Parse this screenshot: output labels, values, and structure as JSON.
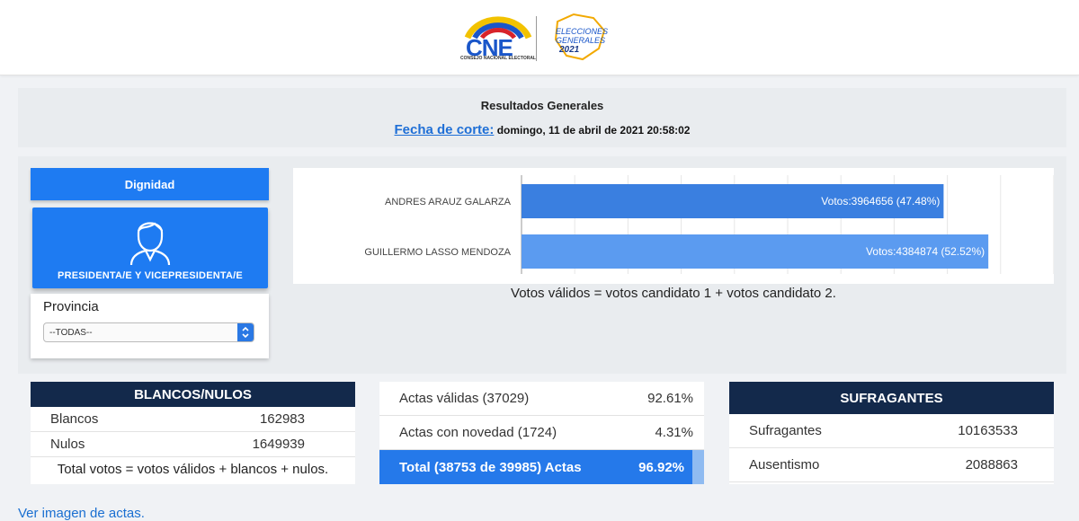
{
  "header": {
    "logo_cne": "CNE",
    "logo_cne_sub": "CONSEJO NACIONAL ELECTORAL",
    "logo_elecciones": "ELECCIONES GENERALES",
    "logo_year": "2021"
  },
  "results": {
    "title": "Resultados Generales",
    "fecha_label": "Fecha de corte:",
    "fecha_value": "domingo, 11 de abril de 2021 20:58:02"
  },
  "sidebar": {
    "dignidad_label": "Dignidad",
    "selected_card_label": "PRESIDENTA/E Y VICEPRESIDENTA/E",
    "provincia_label": "Provincia",
    "provincia_value": "--TODAS--"
  },
  "chart_data": {
    "type": "bar",
    "orientation": "horizontal",
    "categories": [
      "ANDRES ARAUZ GALARZA",
      "GUILLERMO LASSO MENDOZA"
    ],
    "values": [
      3964656,
      4384874
    ],
    "percentages": [
      47.48,
      52.52
    ],
    "data_labels": [
      "Votos:3964656 (47.48%)",
      "Votos:4384874 (52.52%)"
    ],
    "colors": [
      "#3a7fe0",
      "#5b9bf0"
    ],
    "xlim": [
      0,
      5000000
    ],
    "grid": true,
    "note": "Votos válidos = votos candidato 1 + votos candidato 2."
  },
  "blancos": {
    "header": "BLANCOS/NULOS",
    "rows": [
      {
        "label": "Blancos",
        "value": "162983"
      },
      {
        "label": "Nulos",
        "value": "1649939"
      }
    ],
    "footer": "Total votos = votos válidos + blancos + nulos."
  },
  "actas": {
    "rows": [
      {
        "label": "Actas válidas (37029)",
        "value": "92.61%"
      },
      {
        "label": "Actas con novedad (1724)",
        "value": "4.31%"
      }
    ],
    "total_label": "Total (38753 de 39985) Actas",
    "total_value": "96.92%",
    "total_progress": 0.9692
  },
  "sufragantes": {
    "header": "SUFRAGANTES",
    "rows": [
      {
        "label": "Sufragantes",
        "value": "10163533"
      },
      {
        "label": "Ausentismo",
        "value": "2088863"
      }
    ]
  },
  "links": {
    "ver_actas": "Ver imagen de actas."
  },
  "colors": {
    "primary": "#1e7bf2",
    "navy": "#13294b",
    "link": "#1a6fd1"
  }
}
